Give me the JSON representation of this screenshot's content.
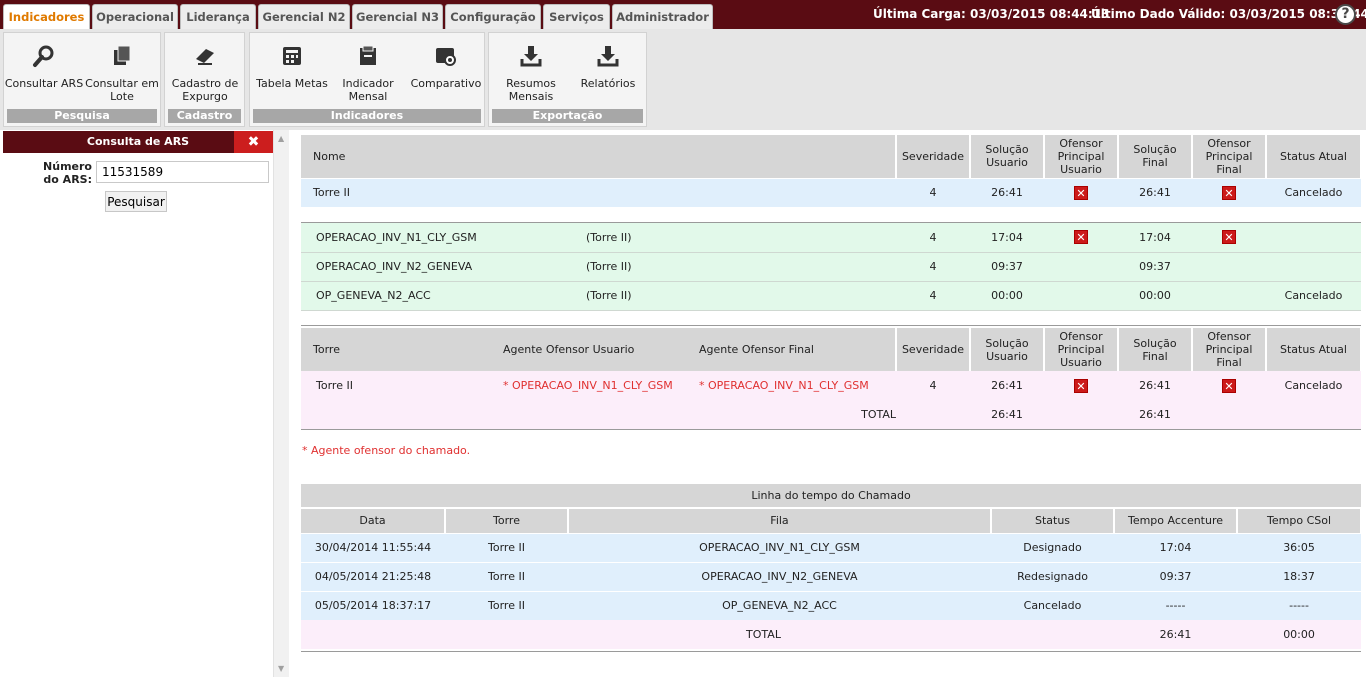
{
  "topbar": {
    "tabs": [
      "Indicadores",
      "Operacional",
      "Liderança",
      "Gerencial N2",
      "Gerencial N3",
      "Configuração",
      "Serviços",
      "Administrador"
    ],
    "active_tab": "Indicadores",
    "ultima_carga": "Última Carga: 03/03/2015 08:44:13",
    "ultimo_dado": "Último Dado Válido: 03/03/2015 08:39:44",
    "help": "?"
  },
  "ribbon": {
    "pesquisa": {
      "title": "Pesquisa",
      "consultar_ars": "Consultar ARS",
      "consultar_lote": "Consultar em Lote"
    },
    "cadastro": {
      "title": "Cadastro",
      "cadastro_expurgo": "Cadastro de Expurgo"
    },
    "indicadores": {
      "title": "Indicadores",
      "tabela_metas": "Tabela Metas",
      "indicador_mensal": "Indicador Mensal",
      "comparativo": "Comparativo"
    },
    "exportacao": {
      "title": "Exportação",
      "resumos_mensais": "Resumos Mensais",
      "relatorios": "Relatórios"
    }
  },
  "left_panel": {
    "title": "Consulta de ARS",
    "close": "✖",
    "field_label": "Número do ARS:",
    "field_value": "11531589",
    "button": "Pesquisar"
  },
  "summary_table": {
    "headers": [
      "Nome",
      "Severidade",
      "Solução Usuario",
      "Ofensor Principal Usuario",
      "Solução Final",
      "Ofensor Principal Final",
      "Status Atual"
    ],
    "main_row": {
      "nome": "Torre II",
      "severidade": "4",
      "sol_usuario": "26:41",
      "ofensor_usuario": true,
      "sol_final": "26:41",
      "ofensor_final": true,
      "status": "Cancelado"
    },
    "queues": [
      {
        "fila": "OPERACAO_INV_N1_CLY_GSM",
        "torre": "(Torre II)",
        "severidade": "4",
        "sol_usuario": "17:04",
        "ofensor_usuario": true,
        "sol_final": "17:04",
        "ofensor_final": true,
        "status": ""
      },
      {
        "fila": "OPERACAO_INV_N2_GENEVA",
        "torre": "(Torre II)",
        "severidade": "4",
        "sol_usuario": "09:37",
        "ofensor_usuario": false,
        "sol_final": "09:37",
        "ofensor_final": false,
        "status": ""
      },
      {
        "fila": "OP_GENEVA_N2_ACC",
        "torre": "(Torre II)",
        "severidade": "4",
        "sol_usuario": "00:00",
        "ofensor_usuario": false,
        "sol_final": "00:00",
        "ofensor_final": false,
        "status": "Cancelado"
      }
    ]
  },
  "torre_table": {
    "headers": [
      "Torre",
      "Agente Ofensor Usuario",
      "Agente Ofensor Final",
      "Severidade",
      "Solução Usuario",
      "Ofensor Principal Usuario",
      "Solução Final",
      "Ofensor Principal Final",
      "Status Atual"
    ],
    "row": {
      "torre": "Torre II",
      "agente_usuario": "* OPERACAO_INV_N1_CLY_GSM",
      "agente_final": "* OPERACAO_INV_N1_CLY_GSM",
      "severidade": "4",
      "sol_usuario": "26:41",
      "sol_final": "26:41",
      "status": "Cancelado"
    },
    "total": {
      "label": "TOTAL",
      "sol_usuario": "26:41",
      "sol_final": "26:41"
    }
  },
  "note": "* Agente ofensor do chamado.",
  "timeline": {
    "title": "Linha do tempo do Chamado",
    "headers": [
      "Data",
      "Torre",
      "Fila",
      "Status",
      "Tempo Accenture",
      "Tempo CSol"
    ],
    "rows": [
      {
        "data": "30/04/2014 11:55:44",
        "torre": "Torre II",
        "fila": "OPERACAO_INV_N1_CLY_GSM",
        "status": "Designado",
        "accenture": "17:04",
        "csol": "36:05"
      },
      {
        "data": "04/05/2014 21:25:48",
        "torre": "Torre II",
        "fila": "OPERACAO_INV_N2_GENEVA",
        "status": "Redesignado",
        "accenture": "09:37",
        "csol": "18:37"
      },
      {
        "data": "05/05/2014 18:37:17",
        "torre": "Torre II",
        "fila": "OP_GENEVA_N2_ACC",
        "status": "Cancelado",
        "accenture": "-----",
        "csol": "-----"
      }
    ],
    "total": {
      "label": "TOTAL",
      "accenture": "26:41",
      "csol": "00:00"
    }
  },
  "colors": {
    "topbar": "#5a0c13",
    "active_tab_text": "#e07a00",
    "row_blue": "#e0effc",
    "row_green": "#e2f9ea",
    "row_pink": "#fceefa",
    "offender_red": "#cc1a1a"
  }
}
